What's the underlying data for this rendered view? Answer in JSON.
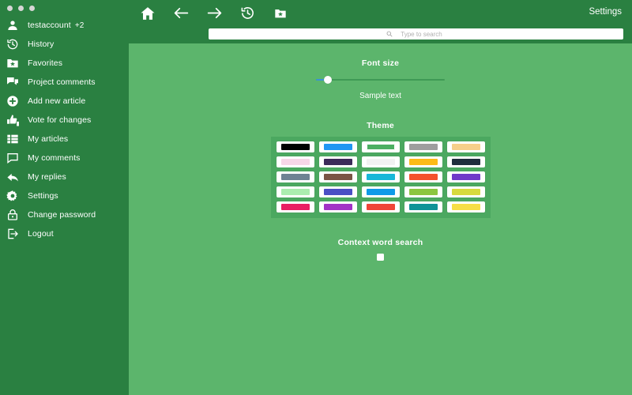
{
  "window": {
    "dots": [
      "close-dot",
      "minimize-dot",
      "maximize-dot"
    ]
  },
  "colors": {
    "sidebar_bg": "#2a8041",
    "topbar_bg": "#2a8041",
    "content_bg": "#5cb56c",
    "theme_panel_bg": "#4ba860",
    "slider_fill": "#3b93d4",
    "slider_track": "#3f9a55",
    "text": "#ffffff"
  },
  "sidebar": {
    "items": [
      {
        "label": "testaccount",
        "badge": "+2",
        "icon": "user-icon",
        "name": "sidebar-item-account"
      },
      {
        "label": "History",
        "badge": "",
        "icon": "history-icon",
        "name": "sidebar-item-history"
      },
      {
        "label": "Favorites",
        "badge": "",
        "icon": "star-folder-icon",
        "name": "sidebar-item-favorites"
      },
      {
        "label": "Project comments",
        "badge": "",
        "icon": "comments-icon",
        "name": "sidebar-item-project-comments"
      },
      {
        "label": "Add new article",
        "badge": "",
        "icon": "plus-circle-icon",
        "name": "sidebar-item-add-new-article"
      },
      {
        "label": "Vote for changes",
        "badge": "",
        "icon": "thumbs-up-down-icon",
        "name": "sidebar-item-vote-for-changes"
      },
      {
        "label": "My articles",
        "badge": "",
        "icon": "list-icon",
        "name": "sidebar-item-my-articles"
      },
      {
        "label": "My comments",
        "badge": "",
        "icon": "comment-icon",
        "name": "sidebar-item-my-comments"
      },
      {
        "label": "My replies",
        "badge": "",
        "icon": "reply-arrow-icon",
        "name": "sidebar-item-my-replies"
      },
      {
        "label": "Settings",
        "badge": "",
        "icon": "gear-icon",
        "name": "sidebar-item-settings"
      },
      {
        "label": "Change password",
        "badge": "",
        "icon": "lock-icon",
        "name": "sidebar-item-change-password"
      },
      {
        "label": "Logout",
        "badge": "",
        "icon": "logout-icon",
        "name": "sidebar-item-logout"
      }
    ]
  },
  "topbar": {
    "buttons": [
      {
        "icon": "home-icon",
        "name": "home-button"
      },
      {
        "icon": "arrow-left-icon",
        "name": "back-button"
      },
      {
        "icon": "arrow-right-icon",
        "name": "forward-button"
      },
      {
        "icon": "history-clock-icon",
        "name": "history-button"
      },
      {
        "icon": "star-folder-icon",
        "name": "bookmarks-button"
      }
    ],
    "settings_label": "Settings"
  },
  "search": {
    "placeholder": "Type to search",
    "value": "",
    "icon": "search-icon"
  },
  "settings": {
    "font_size": {
      "title": "Font size",
      "sample_label": "Sample text",
      "value_percent": 9
    },
    "theme": {
      "title": "Theme",
      "selected_index": 2,
      "swatches": [
        [
          {
            "color": "#000000",
            "name": "theme-swatch-black"
          },
          {
            "color": "#2196f3",
            "name": "theme-swatch-blue"
          },
          {
            "color": "#4caf62",
            "name": "theme-swatch-green"
          },
          {
            "color": "#9e9e9e",
            "name": "theme-swatch-gray"
          },
          {
            "color": "#f6cf8a",
            "name": "theme-swatch-sand"
          }
        ],
        [
          {
            "color": "#f7d7e8",
            "name": "theme-swatch-pink-light"
          },
          {
            "color": "#3b2a59",
            "name": "theme-swatch-dark-purple"
          },
          {
            "color": "#f2f2f2",
            "name": "theme-swatch-white"
          },
          {
            "color": "#fcbb18",
            "name": "theme-swatch-amber"
          },
          {
            "color": "#1f2d3d",
            "name": "theme-swatch-navy"
          }
        ],
        [
          {
            "color": "#6e8293",
            "name": "theme-swatch-slate"
          },
          {
            "color": "#7a5445",
            "name": "theme-swatch-brown"
          },
          {
            "color": "#18b7d8",
            "name": "theme-swatch-cyan"
          },
          {
            "color": "#f4512c",
            "name": "theme-swatch-orange-red"
          },
          {
            "color": "#6f39c9",
            "name": "theme-swatch-violet"
          }
        ],
        [
          {
            "color": "#abedaf",
            "name": "theme-swatch-mint"
          },
          {
            "color": "#4a4fc4",
            "name": "theme-swatch-indigo"
          },
          {
            "color": "#0f9ae8",
            "name": "theme-swatch-bright-blue"
          },
          {
            "color": "#8cc63f",
            "name": "theme-swatch-lime-green"
          },
          {
            "color": "#d7da3e",
            "name": "theme-swatch-olive-yellow"
          }
        ],
        [
          {
            "color": "#e91e63",
            "name": "theme-swatch-magenta"
          },
          {
            "color": "#a232c6",
            "name": "theme-swatch-purple"
          },
          {
            "color": "#f04438",
            "name": "theme-swatch-red"
          },
          {
            "color": "#0f9397",
            "name": "theme-swatch-teal"
          },
          {
            "color": "#f6de46",
            "name": "theme-swatch-yellow"
          }
        ]
      ]
    },
    "context_word_search": {
      "title": "Context word search",
      "checked": false
    }
  }
}
